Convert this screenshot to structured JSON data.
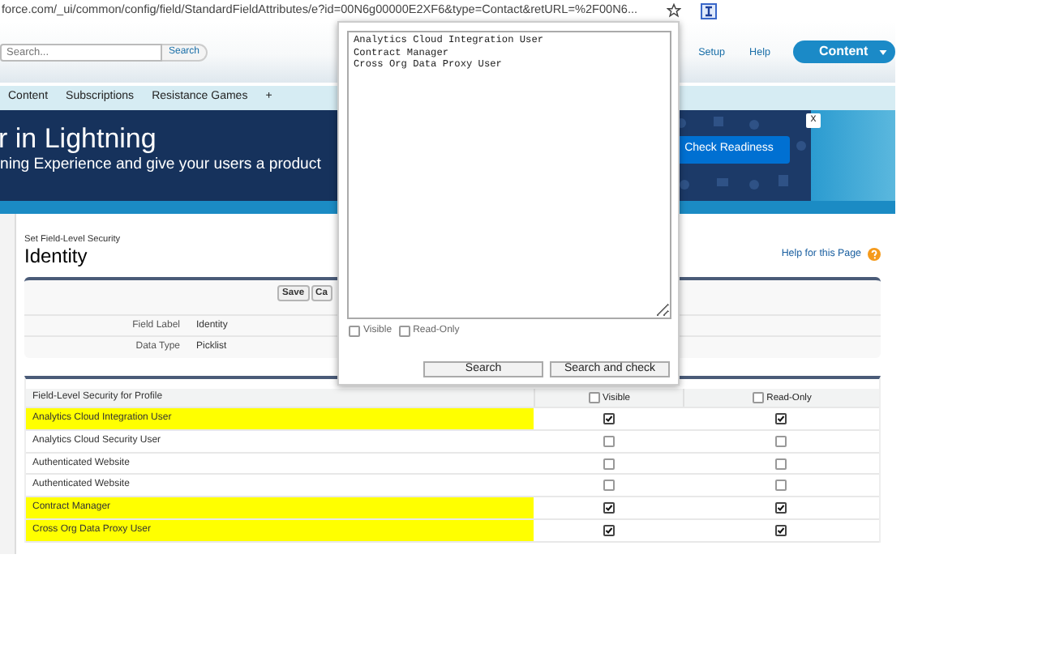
{
  "browser": {
    "url": "force.com/_ui/common/config/field/StandardFieldAttributes/e?id=00N6g00000E2XF6&type=Contact&retURL=%2F00N6..."
  },
  "header": {
    "search_placeholder": "Search...",
    "search_button": "Search",
    "links": [
      "Setup",
      "Help"
    ],
    "app_button": "Content"
  },
  "tabs": [
    {
      "label": "Content"
    },
    {
      "label": "Subscriptions"
    },
    {
      "label": "Resistance Games"
    },
    {
      "label": "+"
    }
  ],
  "banner": {
    "title": "r in Lightning",
    "text": "ning Experience and give your users a product",
    "button": "Check Readiness",
    "close": "x"
  },
  "page": {
    "breadcrumb": "Set Field-Level Security",
    "title": "Identity",
    "help": "Help for this Page"
  },
  "detail": {
    "buttons": [
      "Save",
      "Ca"
    ],
    "fields": [
      {
        "label": "Field Label",
        "value": "Identity"
      },
      {
        "label": "Data Type",
        "value": "Picklist"
      }
    ]
  },
  "profiles": {
    "columns": [
      {
        "kind": "text",
        "label": "Field-Level Security for Profile"
      },
      {
        "kind": "check",
        "label": "Visible",
        "checked": false
      },
      {
        "kind": "check",
        "label": "Read-Only",
        "checked": false
      }
    ],
    "rows": [
      {
        "name": "Analytics Cloud Integration User",
        "highlighted": true,
        "visible": true,
        "read_only": true
      },
      {
        "name": "Analytics Cloud Security User",
        "highlighted": false,
        "visible": false,
        "read_only": false
      },
      {
        "name": "Authenticated Website",
        "highlighted": false,
        "visible": false,
        "read_only": false
      },
      {
        "name": "Authenticated Website",
        "highlighted": false,
        "visible": false,
        "read_only": false
      },
      {
        "name": "Contract Manager",
        "highlighted": true,
        "visible": true,
        "read_only": true
      },
      {
        "name": "Cross Org Data Proxy User",
        "highlighted": true,
        "visible": true,
        "read_only": true
      }
    ]
  },
  "popup": {
    "text": "Analytics Cloud Integration User\nContract Manager\nCross Org Data Proxy User",
    "options": [
      {
        "label": "Visible",
        "checked": false
      },
      {
        "label": "Read-Only",
        "checked": false
      }
    ],
    "buttons": [
      "Search",
      "Search and check"
    ]
  }
}
